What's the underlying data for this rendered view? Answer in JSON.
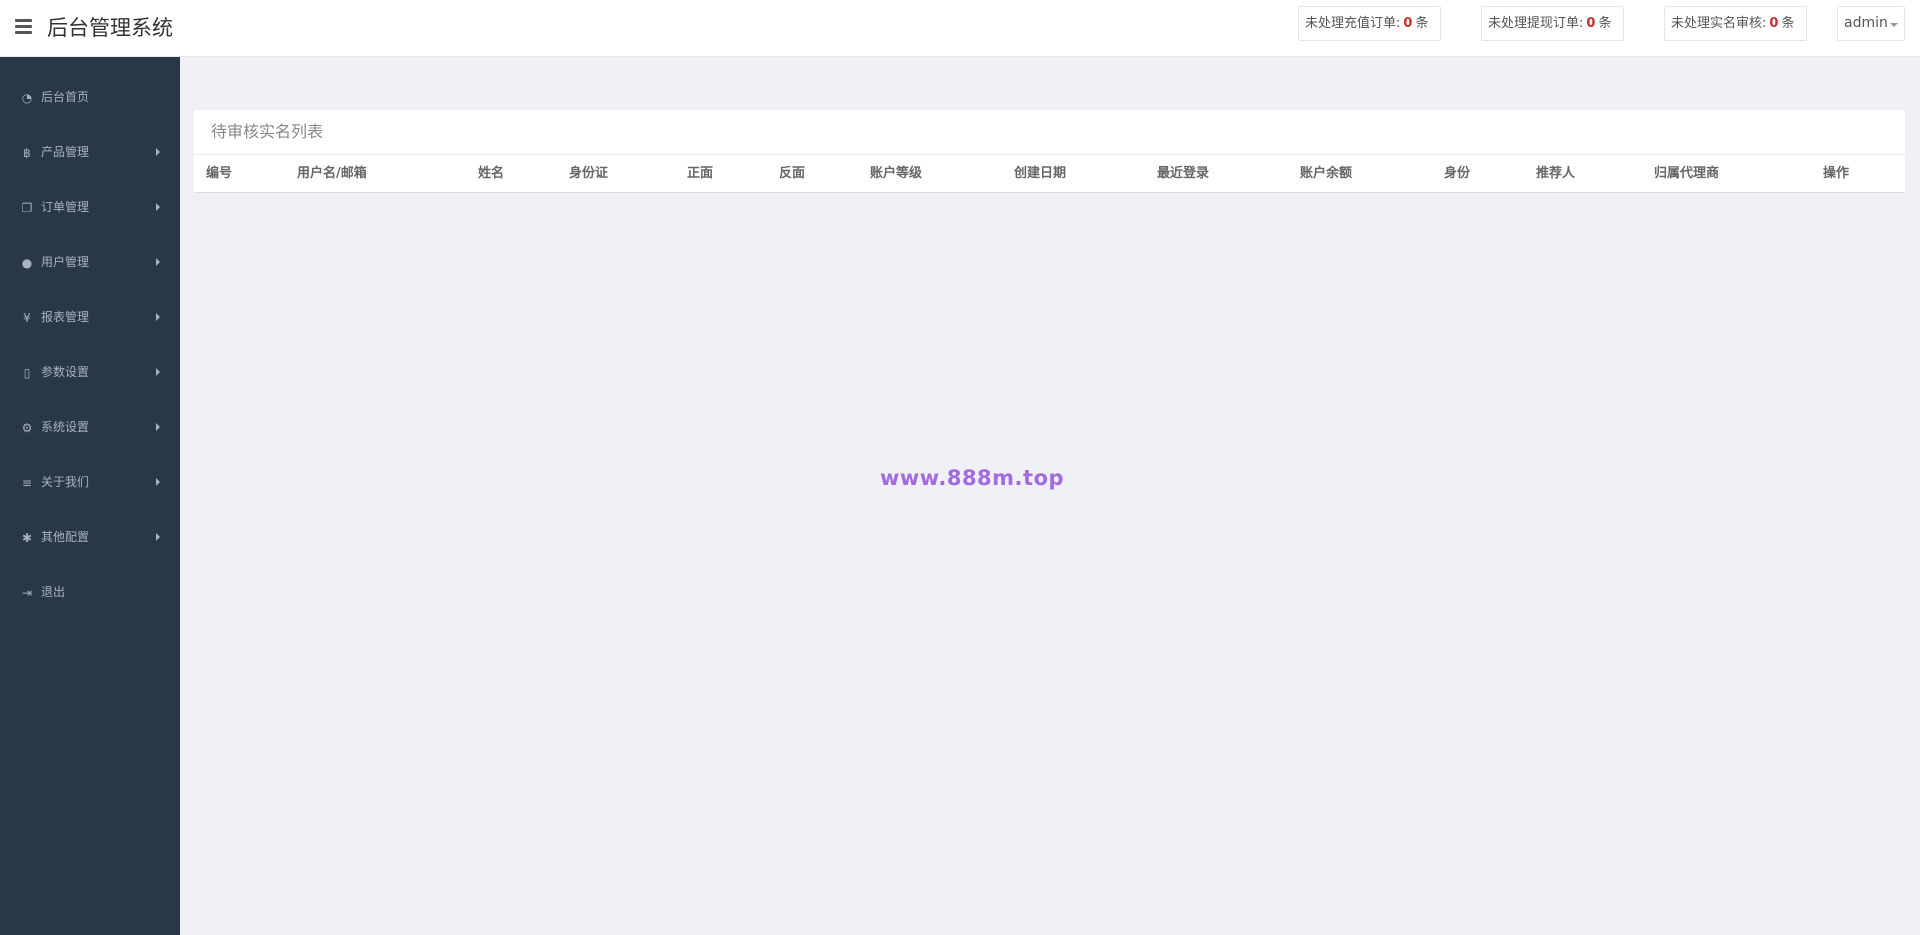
{
  "header": {
    "title": "后台管理系统",
    "stats": [
      {
        "label": "未处理充值订单:",
        "count": "0",
        "unit": "条"
      },
      {
        "label": "未处理提现订单:",
        "count": "0",
        "unit": "条"
      },
      {
        "label": "未处理实名审核:",
        "count": "0",
        "unit": "条"
      }
    ],
    "user": "admin"
  },
  "sidebar": {
    "items": [
      {
        "label": "后台首页",
        "icon": "dashboard-icon",
        "glyph": "◔"
      },
      {
        "label": "产品管理",
        "icon": "bitcoin-icon",
        "glyph": "฿"
      },
      {
        "label": "订单管理",
        "icon": "copy-icon",
        "glyph": "❐"
      },
      {
        "label": "用户管理",
        "icon": "user-icon",
        "glyph": "●"
      },
      {
        "label": "报表管理",
        "icon": "yen-icon",
        "glyph": "¥"
      },
      {
        "label": "参数设置",
        "icon": "file-icon",
        "glyph": "▯"
      },
      {
        "label": "系统设置",
        "icon": "gears-icon",
        "glyph": "⚙"
      },
      {
        "label": "关于我们",
        "icon": "list-icon",
        "glyph": "≡"
      },
      {
        "label": "其他配置",
        "icon": "gear-icon",
        "glyph": "✱"
      },
      {
        "label": "退出",
        "icon": "sign-out-icon",
        "glyph": "⇥"
      }
    ]
  },
  "main": {
    "panel_title": "待审核实名列表",
    "columns": [
      "编号",
      "用户名/邮箱",
      "姓名",
      "身份证",
      "正面",
      "反面",
      "账户等级",
      "创建日期",
      "最近登录",
      "账户余额",
      "身份",
      "推荐人",
      "归属代理商",
      "操作"
    ],
    "watermark": "www.888m.top"
  }
}
